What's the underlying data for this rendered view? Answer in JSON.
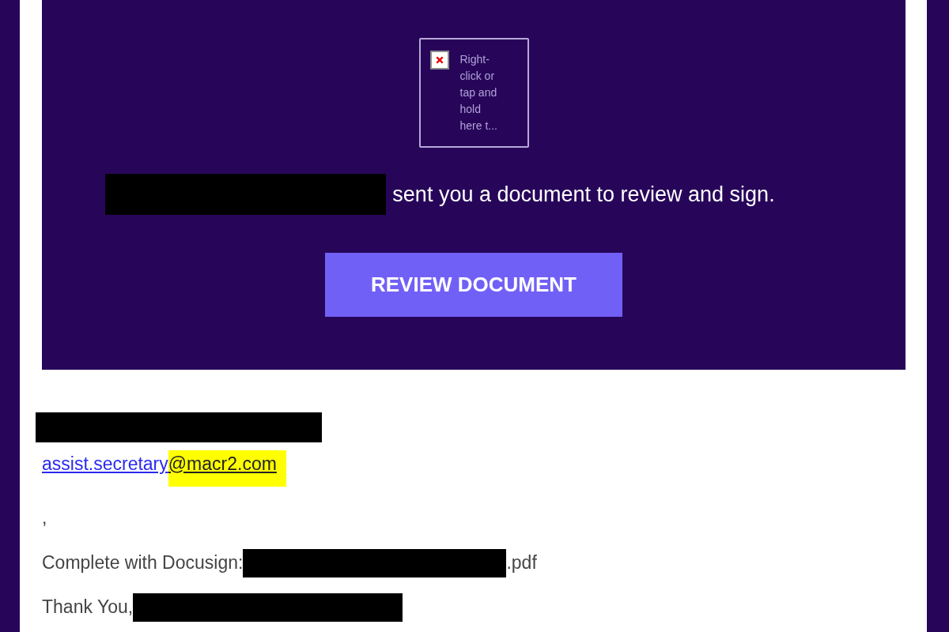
{
  "banner": {
    "broken_image_text": "Right-click or tap and hold here t...",
    "message": "sent you a document to review and sign.",
    "button": "REVIEW DOCUMENT"
  },
  "sender_email": {
    "local_part": "assist.secretary",
    "highlighted_part": "@macr2.com"
  },
  "body": {
    "comma": ",",
    "complete_prefix": "Complete with Docusign:",
    "complete_suffix": ".pdf",
    "closing": "Thank You,"
  }
}
